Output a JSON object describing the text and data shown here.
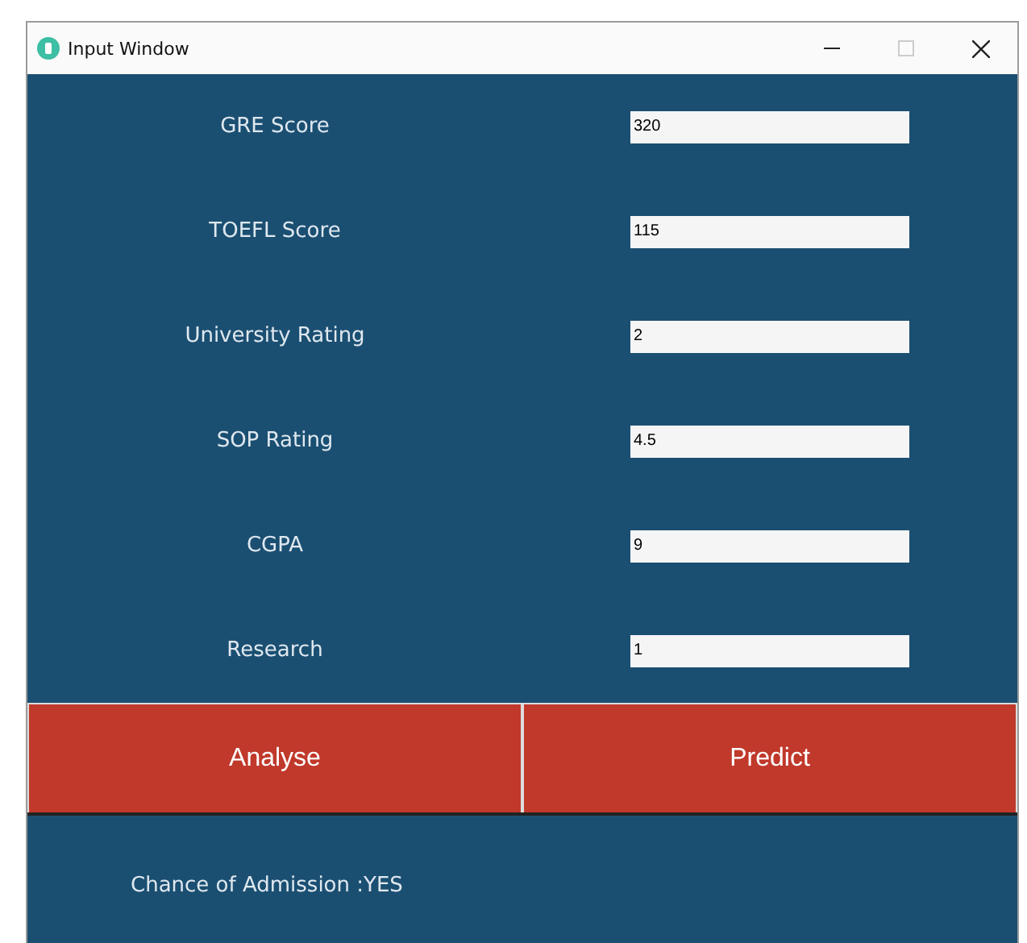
{
  "window": {
    "title": "Input Window"
  },
  "fields": [
    {
      "label": "GRE Score",
      "value": "320"
    },
    {
      "label": "TOEFL Score",
      "value": "115"
    },
    {
      "label": "University Rating",
      "value": "2"
    },
    {
      "label": "SOP Rating",
      "value": "4.5"
    },
    {
      "label": "CGPA",
      "value": "9"
    },
    {
      "label": "Research",
      "value": "1"
    }
  ],
  "buttons": [
    "Analyse",
    "Predict"
  ],
  "result": "Chance of Admission :YES"
}
